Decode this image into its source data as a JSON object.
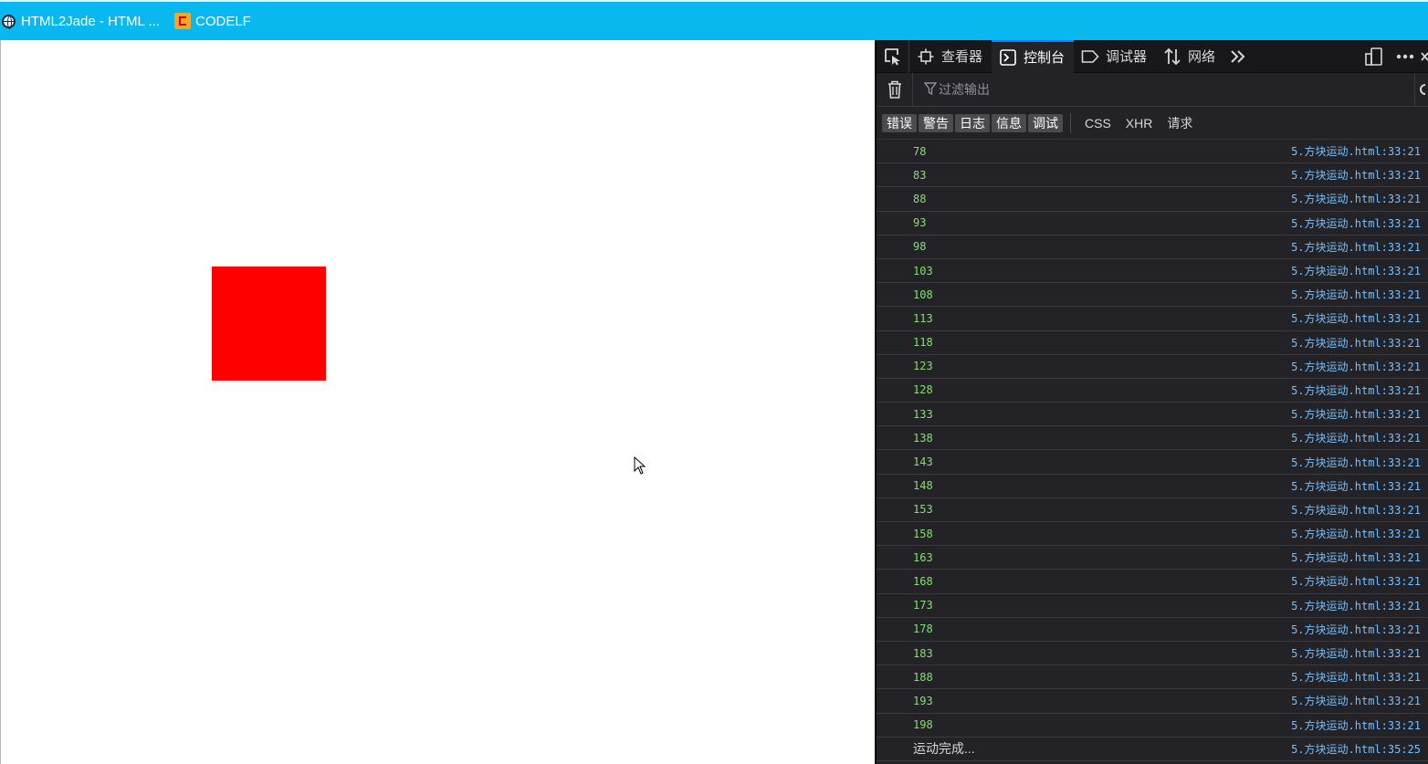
{
  "bookmarks": [
    {
      "label": "HTML2Jade - HTML ...",
      "icon": "globe-icon"
    },
    {
      "label": "CODELF",
      "icon": "codelf-icon"
    }
  ],
  "page": {
    "box_color": "#ff0000"
  },
  "devtools": {
    "tabs": [
      {
        "label": "查看器",
        "icon": "inspector-icon",
        "selected": false
      },
      {
        "label": "控制台",
        "icon": "console-icon",
        "selected": true
      },
      {
        "label": "调试器",
        "icon": "debugger-icon",
        "selected": false
      },
      {
        "label": "网络",
        "icon": "network-icon",
        "selected": false
      }
    ],
    "filter_placeholder": "过滤输出",
    "levels": [
      "错误",
      "警告",
      "日志",
      "信息",
      "调试"
    ],
    "requests": [
      "CSS",
      "XHR",
      "请求"
    ],
    "log": [
      {
        "value": "78",
        "source": "5.方块运动.html:33:21"
      },
      {
        "value": "83",
        "source": "5.方块运动.html:33:21"
      },
      {
        "value": "88",
        "source": "5.方块运动.html:33:21"
      },
      {
        "value": "93",
        "source": "5.方块运动.html:33:21"
      },
      {
        "value": "98",
        "source": "5.方块运动.html:33:21"
      },
      {
        "value": "103",
        "source": "5.方块运动.html:33:21"
      },
      {
        "value": "108",
        "source": "5.方块运动.html:33:21"
      },
      {
        "value": "113",
        "source": "5.方块运动.html:33:21"
      },
      {
        "value": "118",
        "source": "5.方块运动.html:33:21"
      },
      {
        "value": "123",
        "source": "5.方块运动.html:33:21"
      },
      {
        "value": "128",
        "source": "5.方块运动.html:33:21"
      },
      {
        "value": "133",
        "source": "5.方块运动.html:33:21"
      },
      {
        "value": "138",
        "source": "5.方块运动.html:33:21"
      },
      {
        "value": "143",
        "source": "5.方块运动.html:33:21"
      },
      {
        "value": "148",
        "source": "5.方块运动.html:33:21"
      },
      {
        "value": "153",
        "source": "5.方块运动.html:33:21"
      },
      {
        "value": "158",
        "source": "5.方块运动.html:33:21"
      },
      {
        "value": "163",
        "source": "5.方块运动.html:33:21"
      },
      {
        "value": "168",
        "source": "5.方块运动.html:33:21"
      },
      {
        "value": "173",
        "source": "5.方块运动.html:33:21"
      },
      {
        "value": "178",
        "source": "5.方块运动.html:33:21"
      },
      {
        "value": "183",
        "source": "5.方块运动.html:33:21"
      },
      {
        "value": "188",
        "source": "5.方块运动.html:33:21"
      },
      {
        "value": "193",
        "source": "5.方块运动.html:33:21"
      },
      {
        "value": "198",
        "source": "5.方块运动.html:33:21"
      },
      {
        "value": "运动完成...",
        "source": "5.方块运动.html:35:25",
        "text": true
      }
    ]
  }
}
